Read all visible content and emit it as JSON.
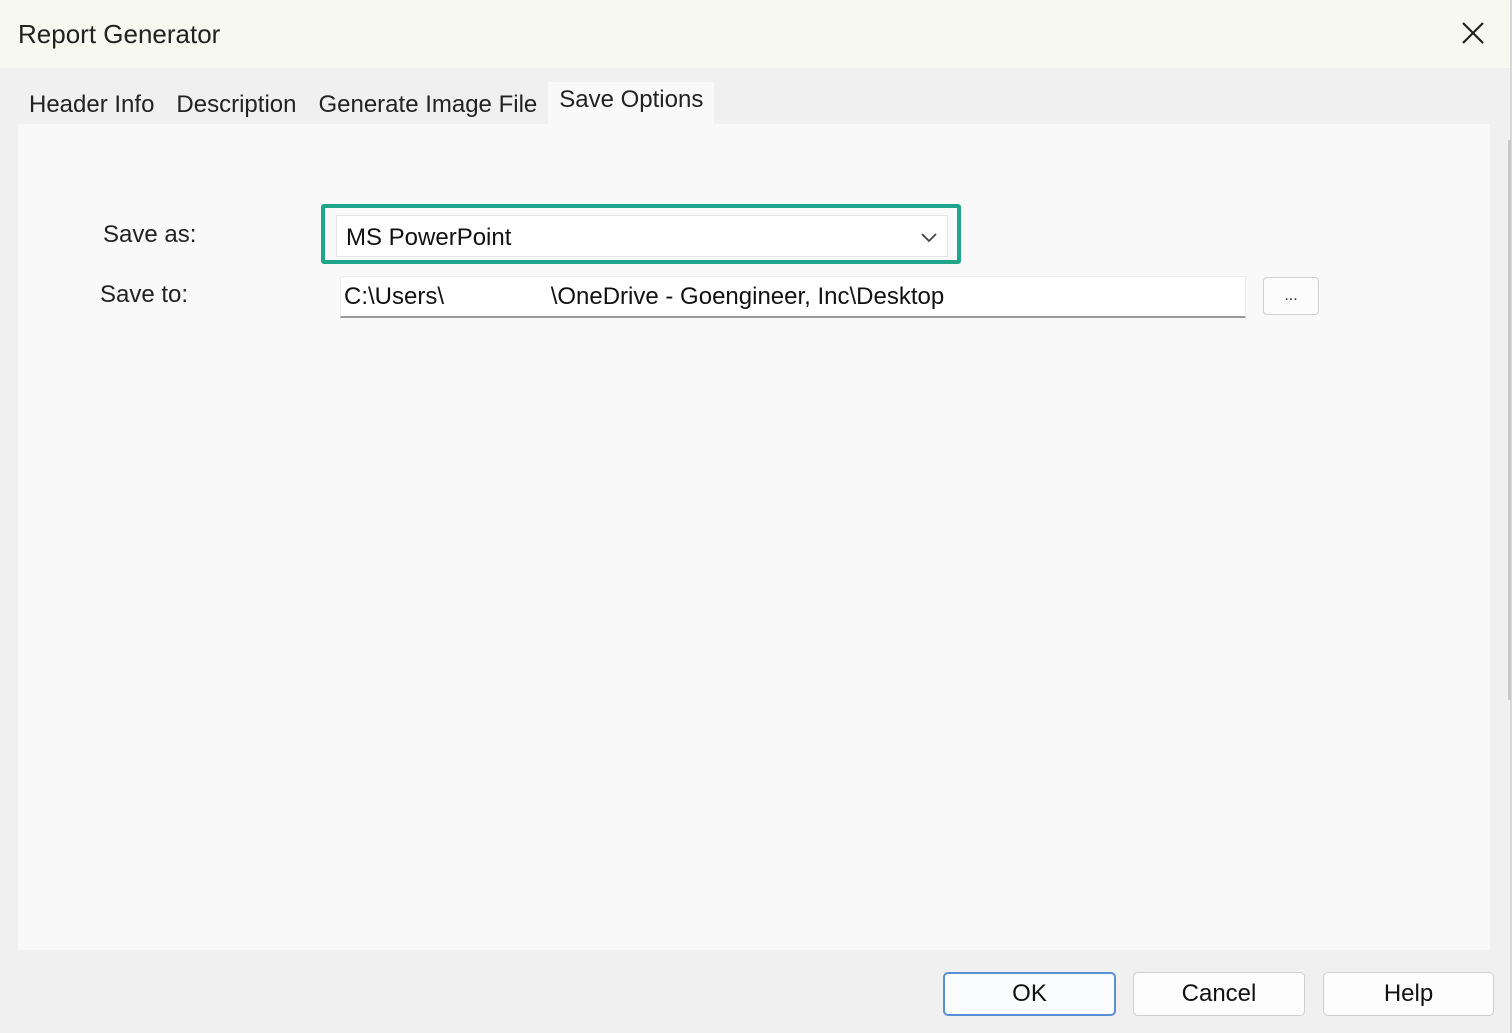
{
  "window": {
    "title": "Report Generator",
    "close_icon": "close-icon"
  },
  "tabs": [
    {
      "label": "Header Info",
      "active": false
    },
    {
      "label": "Description",
      "active": false
    },
    {
      "label": "Generate Image File",
      "active": false
    },
    {
      "label": "Save Options",
      "active": true
    }
  ],
  "save_options": {
    "save_as_label": "Save as:",
    "save_as_value": "MS PowerPoint",
    "save_to_label": "Save to:",
    "save_to_value": "C:\\Users\\                \\OneDrive - Goengineer, Inc\\Desktop",
    "browse_label": "..."
  },
  "buttons": {
    "ok": "OK",
    "cancel": "Cancel",
    "help": "Help"
  },
  "colors": {
    "highlight": "#1fa58a",
    "default_button_border": "#5a8fd6"
  }
}
